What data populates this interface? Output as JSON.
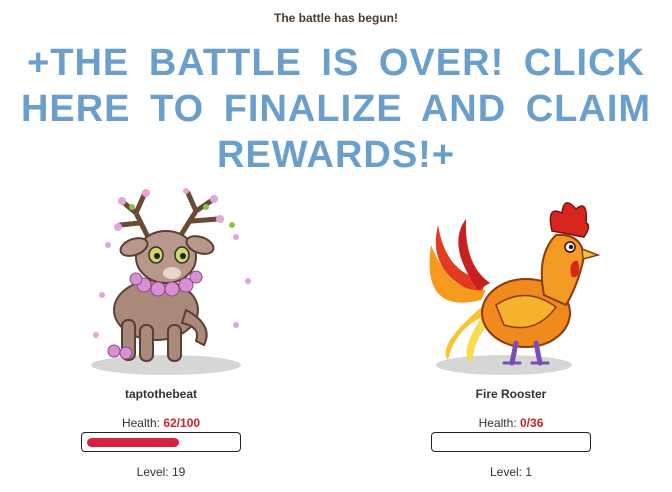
{
  "status_text": "The battle has begun!",
  "banner_text": "+THE BATTLE IS OVER! CLICK HERE TO FINALIZE AND CLAIM REWARDS!+",
  "player": {
    "name": "taptothebeat",
    "health_label": "Health: ",
    "health_current": "62",
    "health_sep": "/",
    "health_max": "100",
    "health_fraction": 0.62,
    "level_text": "Level: 19",
    "portrait_icon": "deer-pet-icon"
  },
  "enemy": {
    "name": "Fire Rooster",
    "health_label": "Health: ",
    "health_current": "0",
    "health_sep": "/",
    "health_max": "36",
    "health_fraction": 0,
    "level_text": "Level: 1",
    "portrait_icon": "rooster-icon"
  },
  "colors": {
    "banner": "#6a9fcb",
    "health_fill": "#d62240",
    "health_value": "#c4262e"
  }
}
